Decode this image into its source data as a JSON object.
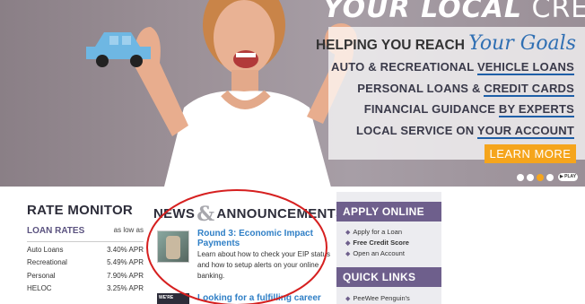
{
  "hero": {
    "top_title_bold": "YOUR LOCAL",
    "top_title_rest": " CREDIT UNION",
    "headline_prefix": "HELPING YOU REACH ",
    "headline_script": "Your Goals",
    "lines": [
      {
        "pre": "AUTO & RECREATIONAL ",
        "ul": "VEHICLE LOANS"
      },
      {
        "pre": "PERSONAL LOANS & ",
        "ul": "CREDIT CARDS"
      },
      {
        "pre": "FINANCIAL GUIDANCE ",
        "ul": "BY EXPERTS"
      },
      {
        "pre": "LOCAL SERVICE ON ",
        "ul": "YOUR ACCOUNT"
      }
    ],
    "cta_label": "LEARN MORE",
    "play_label": "▶ PLAY",
    "slides": 4,
    "active_slide": 3
  },
  "rate_monitor": {
    "title": "RATE MONITOR",
    "header_label": "LOAN RATES",
    "header_note": "as low as",
    "rows": [
      {
        "name": "Auto Loans",
        "value": "3.40% APR"
      },
      {
        "name": "Recreational",
        "value": "5.49% APR"
      },
      {
        "name": "Personal",
        "value": "7.90% APR"
      },
      {
        "name": "HELOC",
        "value": "3.25% APR"
      }
    ]
  },
  "news": {
    "title_left": "NEWS",
    "title_amp": "&",
    "title_right": "ANNOUNCEMENTS",
    "item1_title": "Round 3: Economic Impact Payments",
    "item1_body": "Learn about how to check your EIP status and how to setup alerts on your online banking.",
    "item2_title": "Looking for a fulfilling career",
    "item2_thumb": "WE'RE"
  },
  "apply_online": {
    "title": "APPLY ONLINE",
    "items": [
      "Apply for a Loan",
      "Free Credit Score",
      "Open an Account"
    ]
  },
  "quick_links": {
    "title": "QUICK LINKS",
    "items": [
      "PeeWee Penguin's"
    ]
  },
  "colors": {
    "accent_purple": "#6e5f8c",
    "link_blue": "#2f7fc6",
    "cta_orange": "#f5a51c",
    "annotation_red": "#d62020"
  }
}
